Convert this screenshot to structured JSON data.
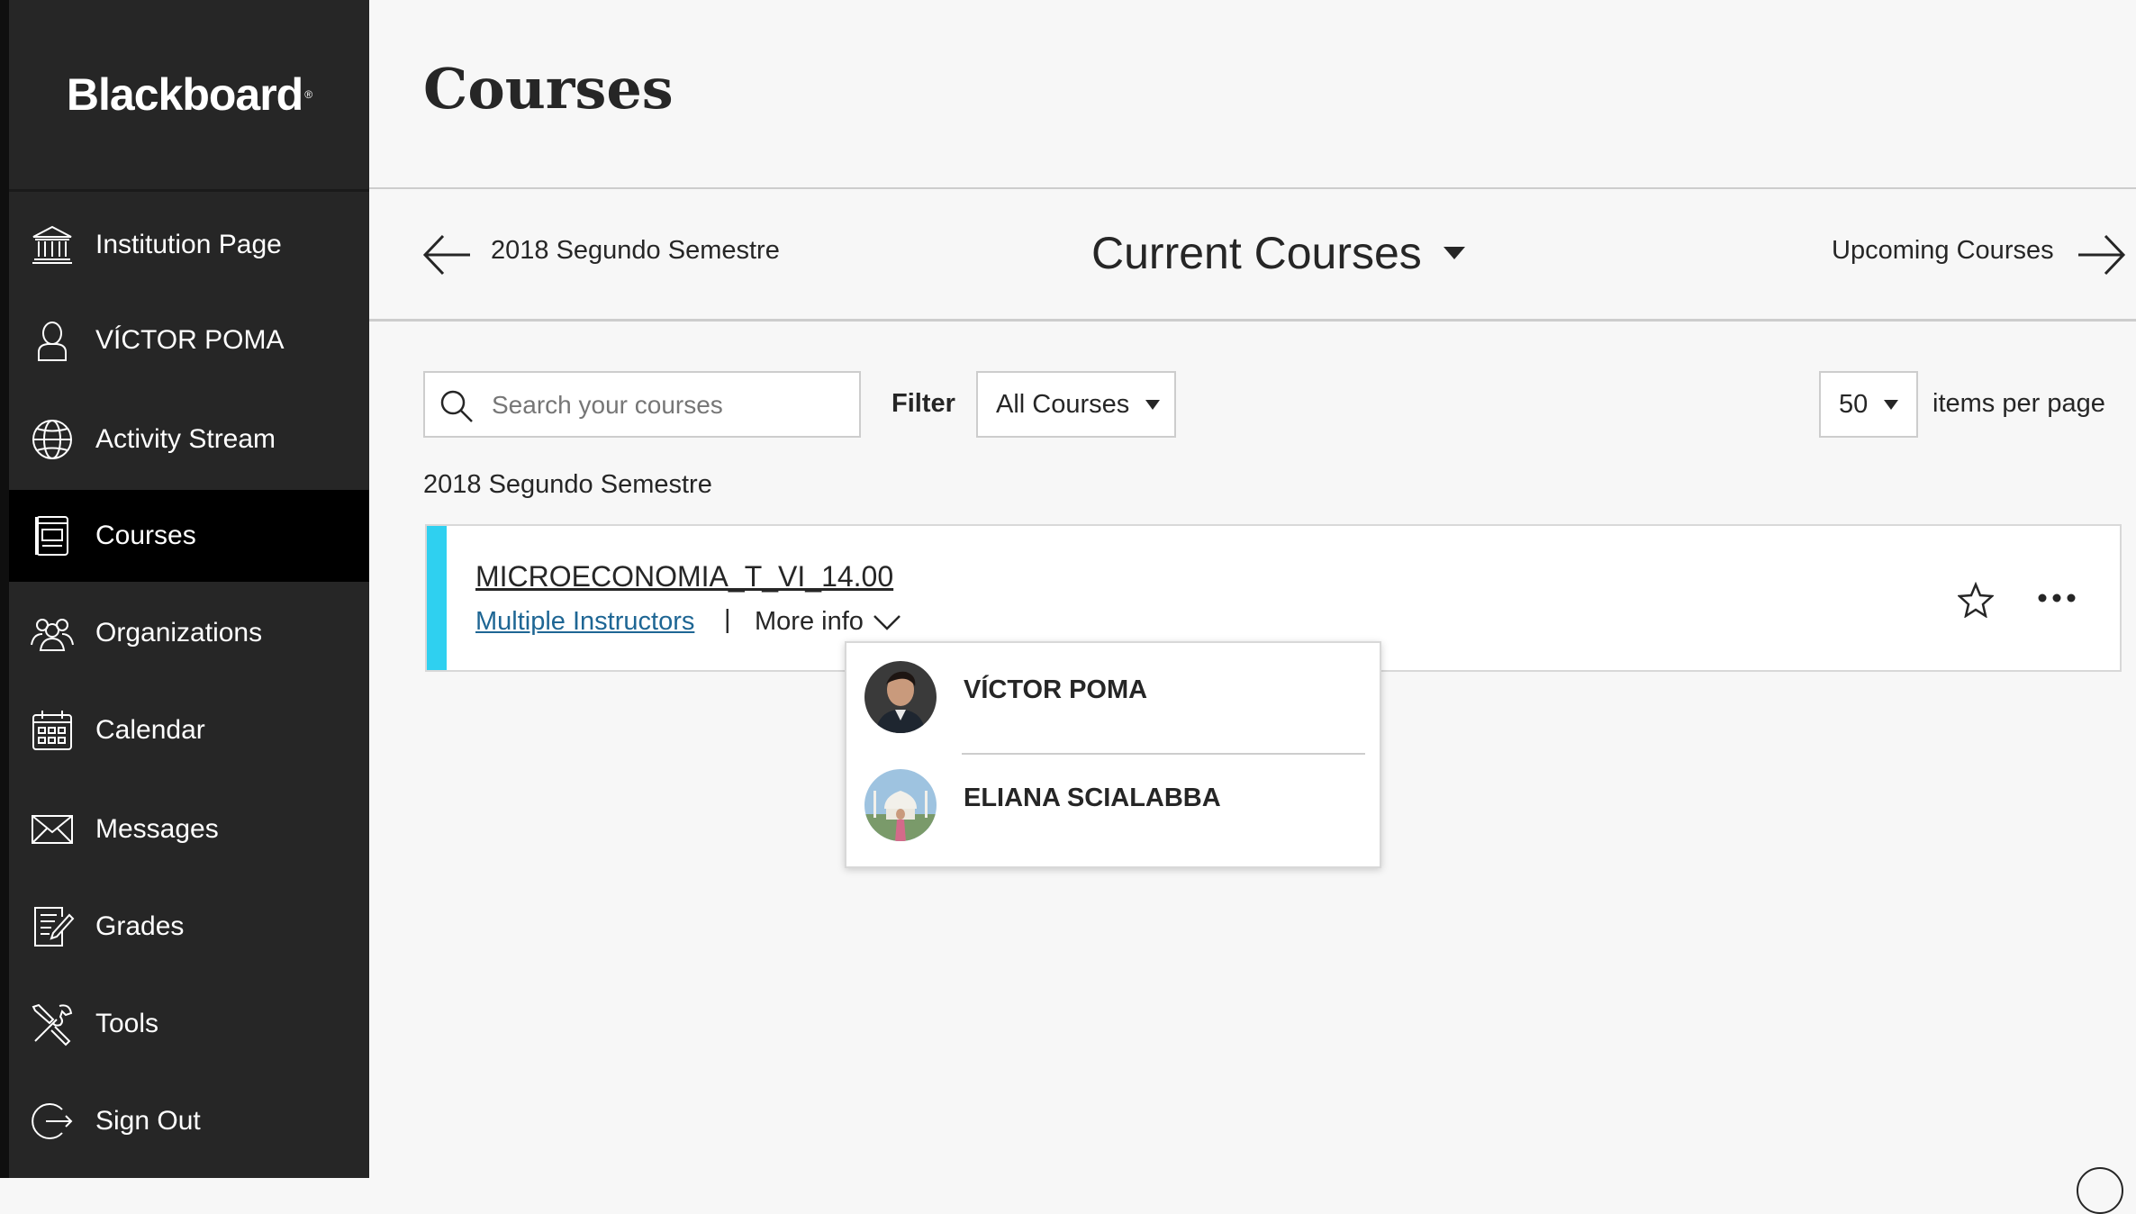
{
  "brand": {
    "name": "Blackboard",
    "mark": "®"
  },
  "nav": [
    {
      "label": "Institution Page",
      "icon": "institution-icon"
    },
    {
      "label": "VÍCTOR POMA",
      "icon": "user-icon"
    },
    {
      "label": "Activity Stream",
      "icon": "globe-icon"
    },
    {
      "label": "Courses",
      "icon": "courses-icon",
      "active": true
    },
    {
      "label": "Organizations",
      "icon": "organizations-icon"
    },
    {
      "label": "Calendar",
      "icon": "calendar-icon"
    },
    {
      "label": "Messages",
      "icon": "envelope-icon"
    },
    {
      "label": "Grades",
      "icon": "grades-icon"
    },
    {
      "label": "Tools",
      "icon": "tools-icon"
    },
    {
      "label": "Sign Out",
      "icon": "sign-out-icon"
    }
  ],
  "page": {
    "title": "Courses"
  },
  "term_nav": {
    "previous": "2018 Segundo Semestre",
    "current": "Current Courses",
    "next": "Upcoming Courses"
  },
  "toolbar": {
    "search_placeholder": "Search your courses",
    "filter_label": "Filter",
    "filter_value": "All Courses",
    "per_page_value": "50",
    "per_page_label": "items per page"
  },
  "term_heading": "2018 Segundo Semestre",
  "course": {
    "title": "MICROECONOMIA_T_VI_14.00",
    "instructors_link": "Multiple Instructors",
    "separator": "|",
    "more_info": "More info",
    "stripe_color": "#2fd0f0"
  },
  "instructors": [
    {
      "name": "VÍCTOR POMA"
    },
    {
      "name": "ELIANA SCIALABBA"
    }
  ],
  "colors": {
    "sidebar": "#262626",
    "active_nav": "#000000",
    "link": "#1e6694",
    "accent": "#2fd0f0"
  }
}
